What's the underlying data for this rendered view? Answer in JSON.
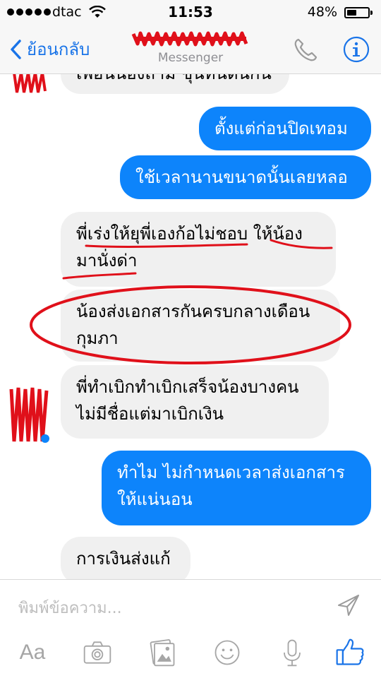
{
  "status_bar": {
    "carrier": "dtac",
    "time": "11:53",
    "battery_percent": "48%",
    "battery_level": 0.48,
    "signal_bars": 5
  },
  "nav": {
    "back_label": "ย้อนกลับ",
    "subtitle": "Messenger",
    "icons": [
      "chevron-left-icon",
      "phone-icon",
      "info-icon"
    ]
  },
  "messages": [
    {
      "side": "received",
      "text": "เพื่อนน้องถาม ขุนทนตนกน"
    },
    {
      "side": "sent",
      "text": "ตั้งแต่ก่อนปิดเทอม"
    },
    {
      "side": "sent",
      "text": "ใช้เวลานานขนาดนั้นเลยหลอ"
    },
    {
      "side": "received",
      "line1": "พี่เร่งให้ยุพี่เองก้อไม่ชอบ ให้น้อง",
      "line2": "มานั่งด่า"
    },
    {
      "side": "received",
      "line1": "น้องส่งเอกสารกันครบกลางเดือน",
      "line2": "กุมภา"
    },
    {
      "side": "received",
      "line1": "พี่ทำเบิกทำเบิกเสร็จน้องบางคน",
      "line2": "ไม่มีชื่อแต่มาเบิกเงิน"
    },
    {
      "side": "sent",
      "line1": "ทำไม ไม่กำหนดเวลาส่งเอกสาร",
      "line2": "ให้แน่นอน"
    },
    {
      "side": "received",
      "text": "การเงินส่งแก้"
    }
  ],
  "composer": {
    "placeholder": "พิมพ์ข้อความ..."
  },
  "toolbar": {
    "aa_label": "Aa",
    "icons": [
      "text-format-icon",
      "camera-icon",
      "gallery-icon",
      "sticker-icon",
      "microphone-icon",
      "like-icon"
    ]
  },
  "colors": {
    "sent_bubble": "#0d84fb",
    "received_bubble": "#f0f0f0",
    "accent": "#1a74e8",
    "annotation_red": "#e0101a"
  }
}
